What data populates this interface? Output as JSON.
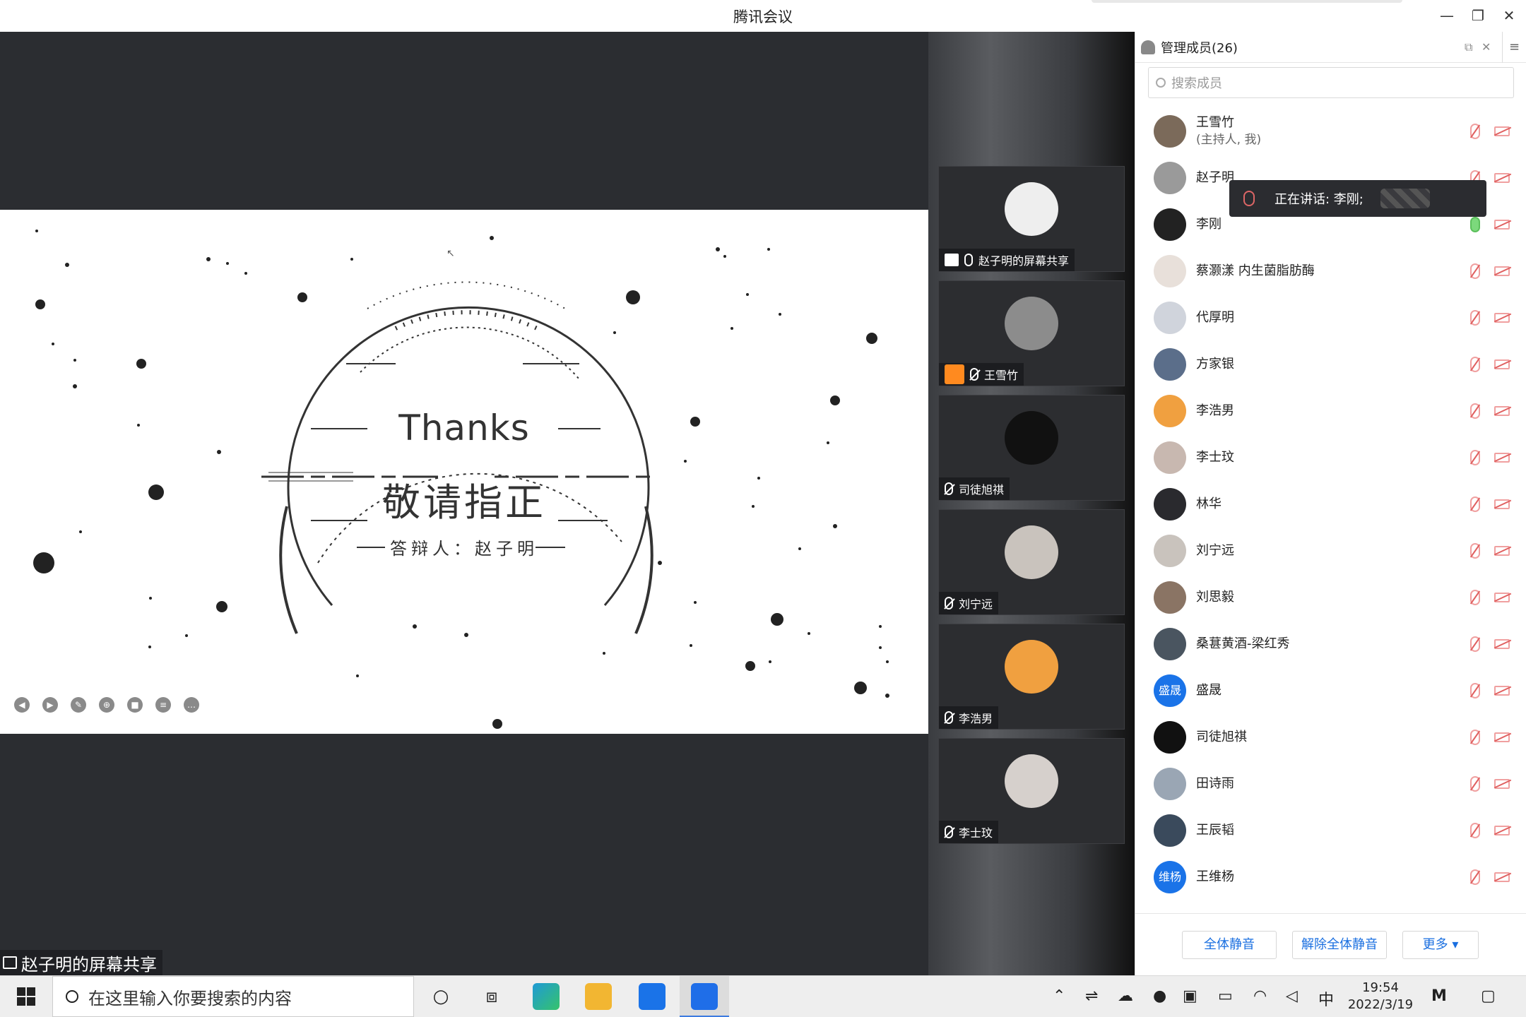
{
  "window": {
    "title": "腾讯会议"
  },
  "slide": {
    "title_en": "Thanks",
    "title_zh": "敬请指正",
    "presenter": "答辩人：赵子明"
  },
  "share_label": "赵子明的屏幕共享",
  "thumbnails": [
    {
      "name": "赵子明的屏幕共享",
      "avatar_color": "#ffffff"
    },
    {
      "name": "王雪竹",
      "avatar_color": "#8c8c8c"
    },
    {
      "name": "司徒旭祺",
      "avatar_color": "#111111"
    },
    {
      "name": "刘宁远",
      "avatar_color": "#c9c3bd"
    },
    {
      "name": "李浩男",
      "avatar_color": "#f0a040"
    },
    {
      "name": "李士玟",
      "avatar_color": "#d6d0cc"
    }
  ],
  "panel": {
    "title": "管理成员(26)",
    "search_placeholder": "搜索成员",
    "speaking": "正在讲话: 李刚;",
    "members": [
      {
        "name": "王雪竹",
        "sub": "(主持人, 我)",
        "avatar_color": "#7b6a5a",
        "mic": "muted"
      },
      {
        "name": "赵子明",
        "sub": "",
        "avatar_color": "#9a9a9a",
        "mic": "muted"
      },
      {
        "name": "李刚",
        "sub": "",
        "avatar_color": "#222222",
        "mic": "on"
      },
      {
        "name": "蔡灏漾 内生菌脂肪酶",
        "sub": "",
        "avatar_color": "#e8e0da",
        "mic": "muted"
      },
      {
        "name": "代厚明",
        "sub": "",
        "avatar_color": "#d0d4dc",
        "mic": "muted"
      },
      {
        "name": "方家银",
        "sub": "",
        "avatar_color": "#5b6e8a",
        "mic": "muted"
      },
      {
        "name": "李浩男",
        "sub": "",
        "avatar_color": "#f0a040",
        "mic": "muted"
      },
      {
        "name": "李士玟",
        "sub": "",
        "avatar_color": "#c8b8b0",
        "mic": "muted"
      },
      {
        "name": "林华",
        "sub": "",
        "avatar_color": "#2a2a2e",
        "mic": "muted"
      },
      {
        "name": "刘宁远",
        "sub": "",
        "avatar_color": "#c9c3bd",
        "mic": "muted"
      },
      {
        "name": "刘思毅",
        "sub": "",
        "avatar_color": "#8a7464",
        "mic": "muted"
      },
      {
        "name": "桑葚黄酒-梁红秀",
        "sub": "",
        "avatar_color": "#4a5560",
        "mic": "muted"
      },
      {
        "name": "盛晟",
        "sub": "",
        "avatar_color": "#1a73e8",
        "badge": "盛晟",
        "mic": "muted"
      },
      {
        "name": "司徒旭祺",
        "sub": "",
        "avatar_color": "#111111",
        "mic": "muted"
      },
      {
        "name": "田诗雨",
        "sub": "",
        "avatar_color": "#9aa6b4",
        "mic": "muted"
      },
      {
        "name": "王辰韬",
        "sub": "",
        "avatar_color": "#3a4a5c",
        "mic": "muted"
      },
      {
        "name": "王维杨",
        "sub": "",
        "avatar_color": "#1a73e8",
        "badge": "维杨",
        "mic": "muted"
      }
    ],
    "footer": {
      "mute_all": "全体静音",
      "unmute_all": "解除全体静音",
      "more": "更多 ▾"
    }
  },
  "taskbar": {
    "search_placeholder": "在这里输入你要搜索的内容",
    "ime": "中",
    "time": "19:54",
    "date": "2022/3/19"
  },
  "colors": {
    "accent": "#1a73e8",
    "stage_bg": "#2b2d31"
  }
}
